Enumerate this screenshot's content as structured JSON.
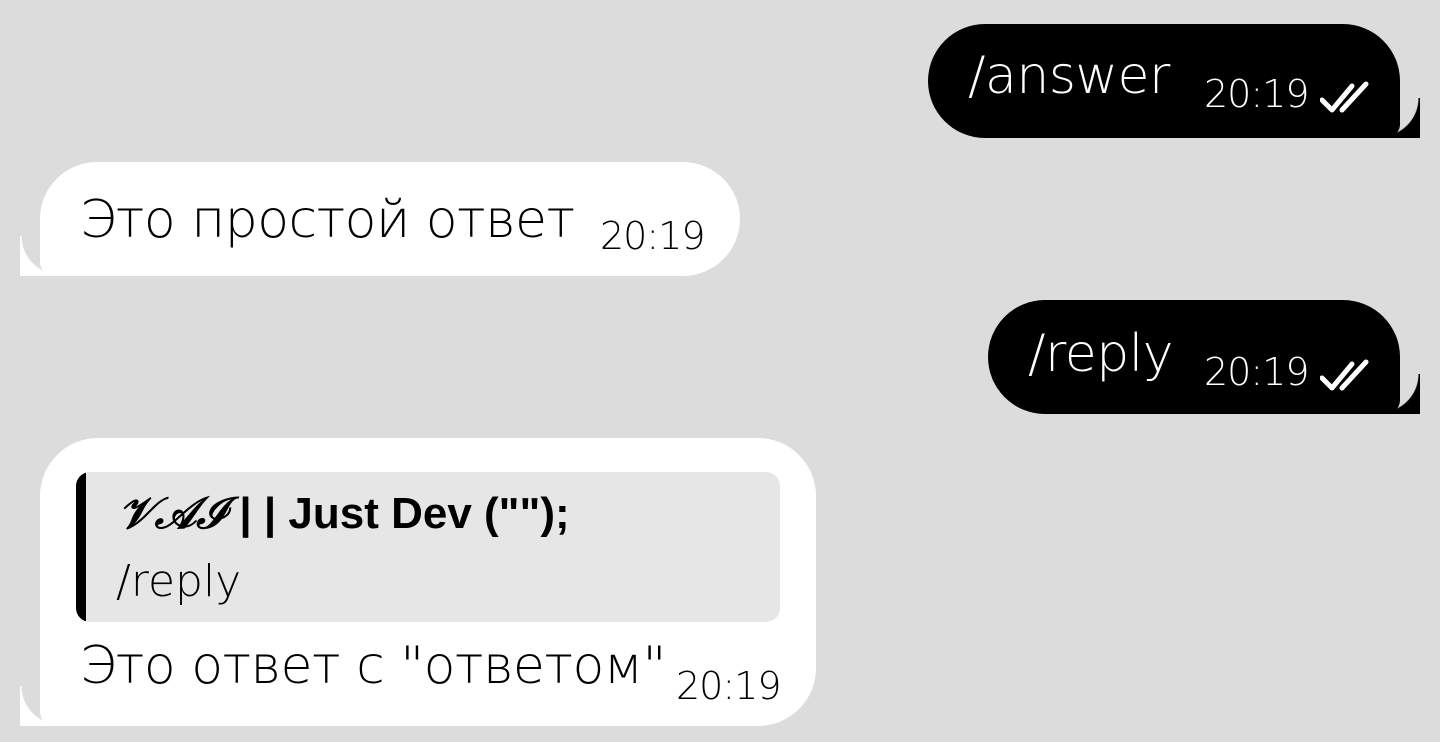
{
  "messages": [
    {
      "direction": "outgoing",
      "text": "/answer",
      "time": "20:19",
      "status_icon": "double-check-icon"
    },
    {
      "direction": "incoming",
      "text": "Это простой ответ",
      "time": "20:19"
    },
    {
      "direction": "outgoing",
      "text": "/reply",
      "time": "20:19",
      "status_icon": "double-check-icon"
    },
    {
      "direction": "incoming",
      "reply": {
        "author_script": "𝒱𝒜ℐ",
        "author_rest": "| | Just Dev (\"\");",
        "text": "/reply"
      },
      "text": "Это ответ с \"ответом\"",
      "time": "20:19"
    }
  ],
  "colors": {
    "background": "#dcdcdc",
    "outgoing_bubble": "#000000",
    "incoming_bubble": "#ffffff",
    "reply_background": "#e6e6e6"
  }
}
